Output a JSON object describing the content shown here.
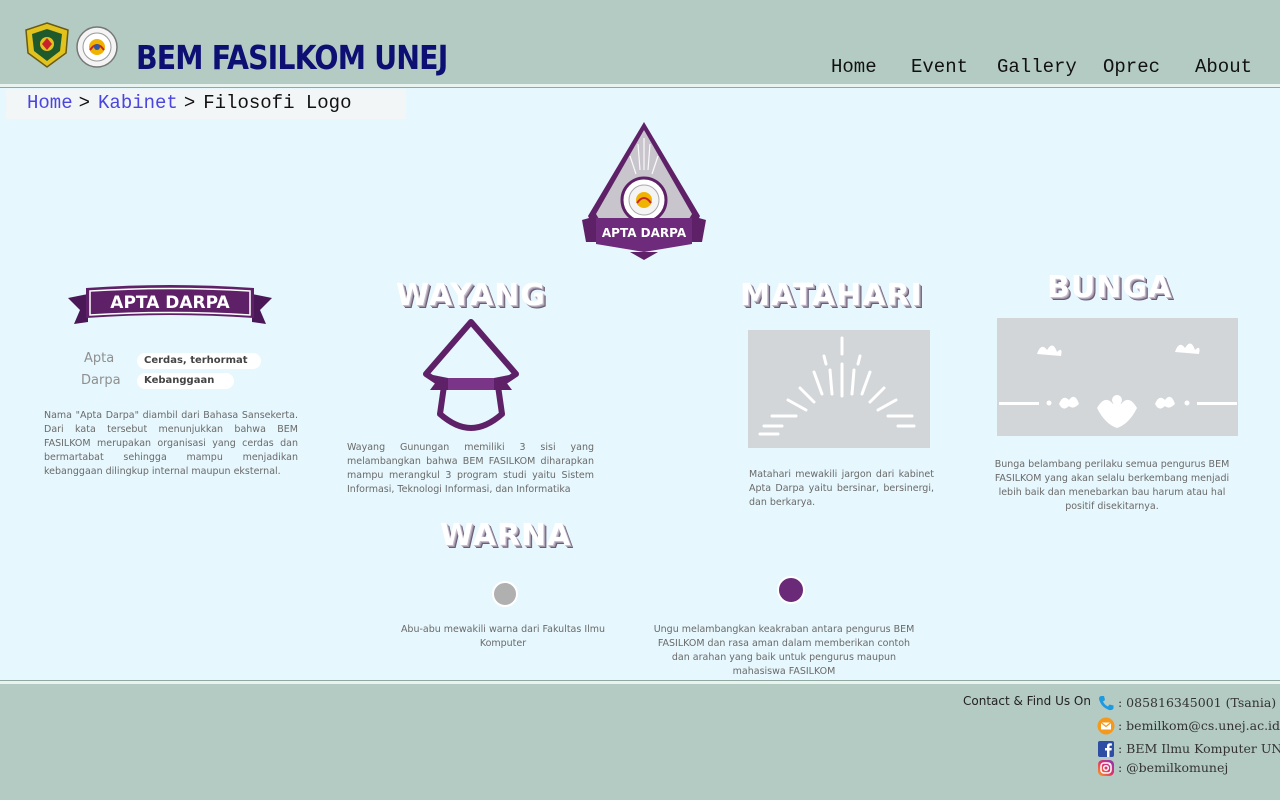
{
  "header": {
    "title": "BEM FASILKOM UNEJ",
    "nav": [
      "Home",
      "Event",
      "Gallery",
      "Oprec",
      "About"
    ]
  },
  "breadcrumb": {
    "items": [
      "Home",
      "Kabinet"
    ],
    "separator": ">",
    "current": "Filosofi Logo"
  },
  "emblem": {
    "ribbon_text": "APTA DARPA"
  },
  "apta_darpa": {
    "ribbon_text": "APTA DARPA",
    "rows": [
      {
        "key": "Apta",
        "value": "Cerdas, terhormat"
      },
      {
        "key": "Darpa",
        "value": "Kebanggaan"
      }
    ],
    "description": "Nama \"Apta Darpa\" diambil dari Bahasa Sansekerta. Dari kata tersebut menunjukkan bahwa BEM FASILKOM merupakan organisasi yang cerdas dan bermartabat sehingga mampu menjadikan kebanggaan dilingkup internal maupun eksternal."
  },
  "wayang": {
    "heading": "WAYANG",
    "description": "Wayang Gunungan memiliki 3 sisi yang melambangkan bahwa BEM FASILKOM diharapkan mampu merangkul 3 program studi yaitu Sistem Informasi, Teknologi Informasi, dan Informatika"
  },
  "matahari": {
    "heading": "MATAHARI",
    "description": "Matahari mewakili jargon dari kabinet Apta Darpa yaitu bersinar, bersinergi, dan berkarya."
  },
  "bunga": {
    "heading": "BUNGA",
    "description": "Bunga belambang perilaku semua pengurus BEM FASILKOM yang akan selalu berkembang menjadi lebih baik dan menebarkan bau harum atau hal positif disekitarnya."
  },
  "warna": {
    "heading": "WARNA",
    "items": [
      {
        "color": "#b0b0b0",
        "description": "Abu-abu mewakili warna dari Fakultas Ilmu Komputer"
      },
      {
        "color": "#6b2a78",
        "description": "Ungu melambangkan keakraban antara pengurus BEM FASILKOM dan rasa aman dalam memberikan contoh dan arahan yang baik untuk pengurus maupun mahasiswa FASILKOM"
      }
    ]
  },
  "footer": {
    "contact_title": "Contact & Find Us On",
    "contacts": [
      {
        "icon": "phone-icon",
        "text": ": 085816345001 (Tsania)"
      },
      {
        "icon": "email-icon",
        "text": ": bemilkom@cs.unej.ac.id"
      },
      {
        "icon": "facebook-icon",
        "text": ": BEM Ilmu Komputer UNEJ"
      },
      {
        "icon": "instagram-icon",
        "text": ": @bemilkomunej"
      }
    ]
  },
  "colors": {
    "header_bg": "#b4cbc3",
    "page_bg": "#e6f7fd",
    "title": "#0d0f73",
    "link": "#4a45e0",
    "purple": "#5e2168"
  }
}
